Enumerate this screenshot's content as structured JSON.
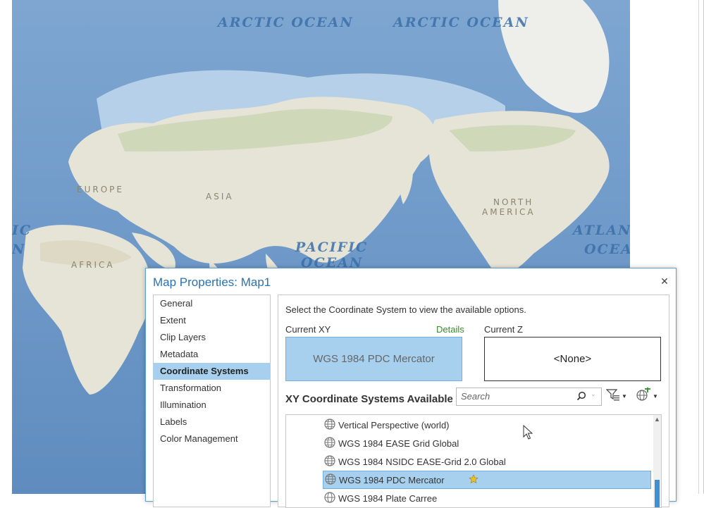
{
  "map": {
    "ocean_labels": [
      "ARCTIC OCEAN",
      "ARCTIC OCEAN",
      "PACIFIC",
      "OCEAN",
      "ATLANT",
      "OCEA",
      "IC",
      "N"
    ],
    "land_labels": [
      "EUROPE",
      "ASIA",
      "AFRICA",
      "NORTH",
      "AMERICA"
    ]
  },
  "dialog": {
    "title": "Map Properties: Map1",
    "close_symbol": "✕",
    "nav_items": [
      {
        "label": "General"
      },
      {
        "label": "Extent"
      },
      {
        "label": "Clip Layers"
      },
      {
        "label": "Metadata"
      },
      {
        "label": "Coordinate Systems",
        "selected": true
      },
      {
        "label": "Transformation"
      },
      {
        "label": "Illumination"
      },
      {
        "label": "Labels"
      },
      {
        "label": "Color Management"
      }
    ],
    "instruction": "Select the Coordinate System to view the available options.",
    "current_xy_label": "Current XY",
    "details_link": "Details",
    "current_z_label": "Current Z",
    "current_xy_value": "WGS 1984 PDC Mercator",
    "current_z_value": "<None>",
    "available_heading": "XY Coordinate Systems Available",
    "search": {
      "placeholder": "Search",
      "value": ""
    },
    "list_items": [
      {
        "label": "Vertical Perspective (world)"
      },
      {
        "label": "WGS 1984 EASE Grid Global"
      },
      {
        "label": "WGS 1984 NSIDC EASE-Grid 2.0 Global"
      },
      {
        "label": "WGS 1984 PDC Mercator",
        "selected": true,
        "favorite": true
      },
      {
        "label": "WGS 1984 Plate Carree"
      }
    ]
  },
  "colors": {
    "accent": "#2a72b0",
    "selection": "#a7d0ef",
    "details_link": "#3c8a2e"
  },
  "icons": [
    "close-icon",
    "search-icon",
    "filter-icon",
    "globe-add-icon",
    "globe-icon",
    "favorite-star-icon",
    "cursor-icon"
  ]
}
